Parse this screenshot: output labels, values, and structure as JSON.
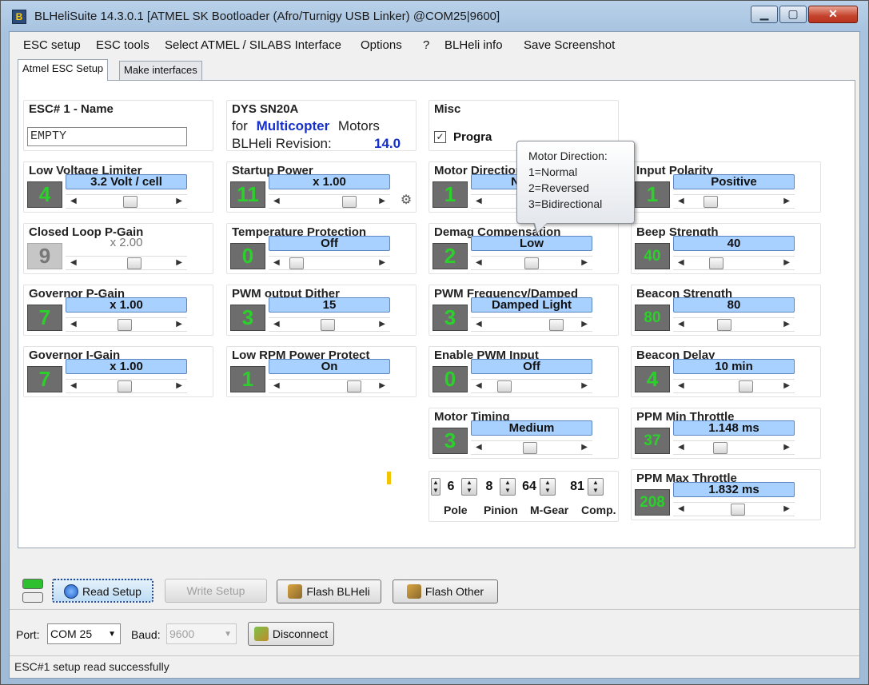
{
  "window": {
    "title": "BLHeliSuite 14.3.0.1  [ATMEL SK Bootloader (Afro/Turnigy USB Linker) @COM25|9600]",
    "controls": {
      "minimize": "▁",
      "maximize": "▢",
      "close": "✕"
    }
  },
  "menu": [
    "ESC setup",
    "ESC tools",
    "Select ATMEL / SILABS Interface",
    "Options",
    "?",
    "BLHeli info",
    "Save Screenshot"
  ],
  "tabs": [
    "Atmel ESC Setup",
    "Make interfaces"
  ],
  "esc_name": {
    "label": "ESC# 1 - Name",
    "value": "EMPTY"
  },
  "esc_info": {
    "model": "DYS SN20A",
    "for_word": "for",
    "type": "Multicopter",
    "motors_word": "Motors",
    "revision_label": "BLHeli Revision:",
    "revision": "14.0"
  },
  "misc": {
    "label": "Misc",
    "checkbox_label": "Progra",
    "checked": true
  },
  "tooltip": {
    "lines": [
      "Motor Direction:",
      "1=Normal",
      "2=Reversed",
      "3=Bidirectional"
    ]
  },
  "params": {
    "low_voltage": {
      "label": "Low Voltage Limiter",
      "num": "4",
      "value": "3.2 Volt / cell",
      "level": 0.55
    },
    "startup_power": {
      "label": "Startup Power",
      "num": "11",
      "value": "x 1.00",
      "level": 0.75
    },
    "motor_direction": {
      "label": "Motor Direction",
      "num": "1",
      "value": "Normal",
      "level": 0.55
    },
    "input_polarity": {
      "label": "Input Polarity",
      "num": "1",
      "value": "Positive",
      "level": 0.2
    },
    "closed_loop": {
      "label": "Closed Loop P-Gain",
      "num": "9",
      "value": "x 2.00",
      "level": 0.6
    },
    "temp_protection": {
      "label": "Temperature Protection",
      "num": "0",
      "value": "Off",
      "level": 0.08
    },
    "demag": {
      "label": "Demag Compensation",
      "num": "2",
      "value": "Low",
      "level": 0.5
    },
    "beep_strength": {
      "label": "Beep Strength",
      "num": "40",
      "value": "40",
      "level": 0.28
    },
    "governor_p": {
      "label": "Governor P-Gain",
      "num": "7",
      "value": "x 1.00",
      "level": 0.48
    },
    "pwm_dither": {
      "label": "PWM output Dither",
      "num": "3",
      "value": "15",
      "level": 0.48
    },
    "pwm_freq": {
      "label": "PWM Frequency/Damped",
      "num": "3",
      "value": "Damped Light",
      "level": 0.82
    },
    "beacon_strength": {
      "label": "Beacon Strength",
      "num": "80",
      "value": "80",
      "level": 0.38
    },
    "governor_i": {
      "label": "Governor I-Gain",
      "num": "7",
      "value": "x 1.00",
      "level": 0.48
    },
    "low_rpm": {
      "label": "Low RPM Power Protect",
      "num": "1",
      "value": "On",
      "level": 0.82
    },
    "enable_pwm": {
      "label": "Enable PWM Input",
      "num": "0",
      "value": "Off",
      "level": 0.15
    },
    "beacon_delay": {
      "label": "Beacon Delay",
      "num": "4",
      "value": "10 min",
      "level": 0.65
    },
    "motor_timing": {
      "label": "Motor Timing",
      "num": "3",
      "value": "Medium",
      "level": 0.48
    },
    "ppm_min": {
      "label": "PPM Min Throttle",
      "num": "37",
      "value": "1.148 ms",
      "level": 0.33
    },
    "ppm_max": {
      "label": "PPM Max Throttle",
      "num": "208",
      "value": "1.832 ms",
      "level": 0.55
    }
  },
  "motor_params": {
    "pole": {
      "label": "Pole",
      "value": "6"
    },
    "pinion": {
      "label": "Pinion",
      "value": "8"
    },
    "mgear": {
      "label": "M-Gear",
      "value": "64"
    },
    "comp": {
      "label": "Comp.",
      "value": "81"
    }
  },
  "buttons": {
    "read": "Read Setup",
    "write": "Write Setup",
    "flash_blheli": "Flash BLHeli",
    "flash_other": "Flash Other",
    "disconnect": "Disconnect"
  },
  "port": {
    "label": "Port:",
    "value": "COM 25",
    "baud_label": "Baud:",
    "baud_value": "9600"
  },
  "status": "ESC#1 setup read successfully",
  "colors": {
    "value_bg": "#a9d1ff",
    "num_text": "#2bd02b",
    "num_bg": "#6d6d6d",
    "accent_blue": "#1530c9"
  }
}
